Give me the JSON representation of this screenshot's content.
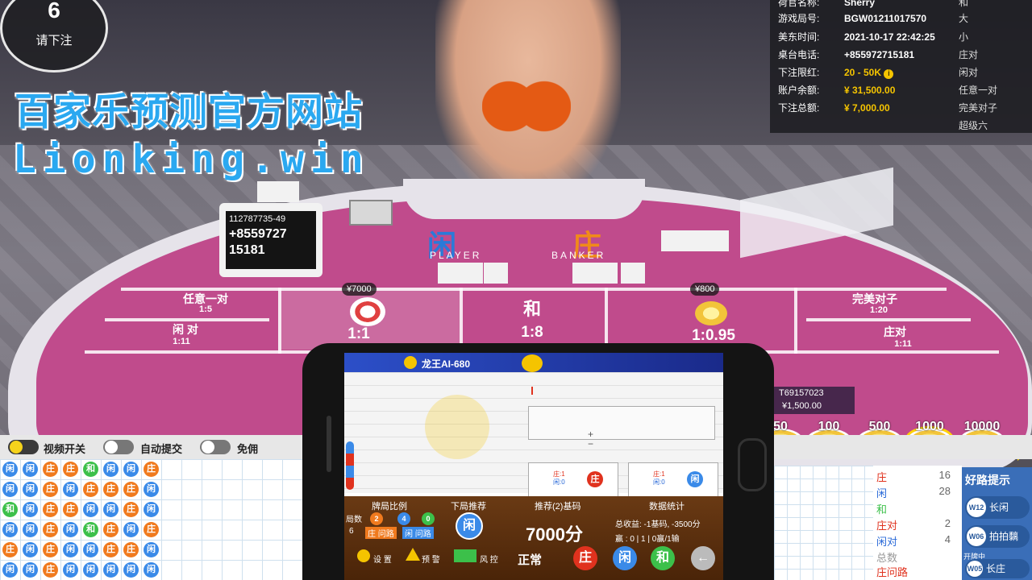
{
  "countdown": {
    "number": "6",
    "label": "请下注"
  },
  "promo": {
    "line1": "百家乐预测官方网站",
    "line2": "Lionking.win"
  },
  "info_panel": {
    "rows": [
      {
        "key": "荷官名称:",
        "value": "Sherry"
      },
      {
        "key": "游戏局号:",
        "value": "BGW01211017570"
      },
      {
        "key": "美东时间:",
        "value": "2021-10-17 22:42:25"
      },
      {
        "key": "桌台电话:",
        "value": "+855972715181"
      },
      {
        "key": "下注限红:",
        "value": "20 - 50K"
      },
      {
        "key": "账户余额:",
        "value": "¥ 31,500.00"
      },
      {
        "key": "下注总额:",
        "value": "¥ 7,000.00"
      }
    ],
    "side_labels": [
      "和",
      "大",
      "小",
      "庄对",
      "闲对",
      "任意一对",
      "完美对子",
      "超级六"
    ]
  },
  "card_stand": {
    "line1": "112787735-49",
    "line2": "+8559727",
    "line3": "15181"
  },
  "table": {
    "player_label": "闲",
    "player_en": "PLAYER",
    "banker_label": "庄",
    "banker_en": "BANKER",
    "any_pair": "任意一对",
    "any_pair_ratio": "1:5",
    "player_pair": "闲 对",
    "player_pair_ratio": "1:11",
    "player_ratio": "1:1",
    "player_bet": "¥7000",
    "tie": "和",
    "tie_ratio": "1:8",
    "banker_ratio": "1:0.95",
    "banker_bet": "¥800",
    "perfect_pair": "完美对子",
    "perfect_pair_ratio": "1:20",
    "banker_pair": "庄对",
    "banker_pair_ratio": "1:11",
    "other_player_id": "T69157023",
    "other_player_bet": "¥1,500.00"
  },
  "chips": [
    "50",
    "100",
    "500",
    "1000",
    "10000"
  ],
  "toggles": [
    {
      "label": "视频开关",
      "on": true
    },
    {
      "label": "自动提交",
      "on": false
    },
    {
      "label": "免佣",
      "on": false
    }
  ],
  "stats": [
    {
      "label": "庄",
      "value": "16",
      "color": "#e0321e"
    },
    {
      "label": "闲",
      "value": "28",
      "color": "#2a6ad8"
    },
    {
      "label": "和",
      "value": "",
      "color": "#3cc04a"
    },
    {
      "label": "庄对",
      "value": "2",
      "color": "#e0321e"
    },
    {
      "label": "闲对",
      "value": "4",
      "color": "#2a6ad8"
    },
    {
      "label": "总数",
      "value": "",
      "color": "#999"
    },
    {
      "label": "庄问路",
      "value": "",
      "color": "#e0321e"
    }
  ],
  "hints": {
    "title": "好路提示",
    "items": [
      {
        "badge": "W12",
        "label": "长闲"
      },
      {
        "badge": "W06",
        "label": "拍拍黐"
      },
      {
        "badge": "W05",
        "label": "长庄",
        "prefix": "开牌中"
      }
    ]
  },
  "phone": {
    "app_title": "龙王AI-680",
    "col_headers": [
      "牌局比例",
      "下局推荐",
      "推荐(2)基码",
      "数据统计"
    ],
    "round_label": "局数",
    "round_value": "6",
    "recommend": "闲",
    "amount": "7000分",
    "total_income": "总收益: -1基码, -3500分",
    "win_lose": "赢 : 0 | 1 | 0赢/1输",
    "buttons": {
      "settings": "设 置",
      "warning": "预 警",
      "risk": "风 控",
      "normal": "正常",
      "banker": "庄",
      "player": "闲",
      "tie": "和"
    },
    "ratio_counts": [
      "2",
      "4",
      "0"
    ],
    "ask_labels": [
      "庄 问路",
      "闲 问路"
    ],
    "hist_b": "庄",
    "hist_p": "闲",
    "mini_labels": [
      "庄:1",
      "闲:0",
      "庄:1",
      "闲:0"
    ]
  },
  "bead_road": [
    [
      "闲",
      "闲",
      "庄",
      "庄",
      "和",
      "闲",
      "闲",
      "庄"
    ],
    [
      "闲",
      "闲",
      "庄",
      "闲",
      "庄",
      "庄",
      "庄",
      "闲"
    ],
    [
      "和",
      "闲",
      "庄",
      "庄",
      "闲",
      "闲",
      "庄",
      "闲"
    ],
    [
      "闲",
      "闲",
      "庄",
      "闲",
      "和",
      "庄",
      "闲",
      "庄"
    ],
    [
      "庄",
      "闲",
      "庄",
      "闲",
      "闲",
      "庄",
      "庄",
      "闲"
    ],
    [
      "闲",
      "闲",
      "庄",
      "闲",
      "闲",
      "闲",
      "闲",
      "闲"
    ]
  ]
}
